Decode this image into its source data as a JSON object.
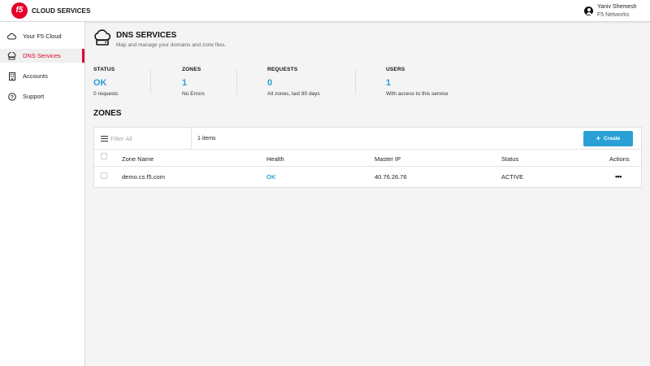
{
  "header": {
    "logo_text": "f5",
    "brand": "CLOUD SERVICES",
    "user_name": "Yaniv Shemesh",
    "user_org": "F5 Networks"
  },
  "sidebar": {
    "items": [
      {
        "label": "Your F5 Cloud",
        "icon": "cloud-icon",
        "active": false
      },
      {
        "label": "DNS Services",
        "icon": "dns-cloud-icon",
        "active": true
      },
      {
        "label": "Accounts",
        "icon": "accounts-icon",
        "active": false
      },
      {
        "label": "Support",
        "icon": "help-icon",
        "active": false
      }
    ]
  },
  "page": {
    "title": "DNS SERVICES",
    "subtitle": "Map and manage your domains and zone files."
  },
  "stats": [
    {
      "label": "STATUS",
      "value": "OK",
      "detail": "0 requests"
    },
    {
      "label": "ZONES",
      "value": "1",
      "detail": "No Errors"
    },
    {
      "label": "REQUESTS",
      "value": "0",
      "detail": "All zones, last 90 days"
    },
    {
      "label": "USERS",
      "value": "1",
      "detail": "With access to this service"
    }
  ],
  "zones": {
    "title": "ZONES",
    "filter_placeholder": "Filter All",
    "item_count": "1 items",
    "create_label": "Create",
    "columns": [
      "Zone Name",
      "Health",
      "Master IP",
      "Status",
      "Actions"
    ],
    "rows": [
      {
        "zone_name": "demo.cs.f5.com",
        "health": "OK",
        "master_ip": "40.76.26.76",
        "status": "ACTIVE",
        "actions": "•••"
      }
    ]
  },
  "colors": {
    "accent": "#2a9fd6",
    "brand_red": "#e4002b"
  }
}
